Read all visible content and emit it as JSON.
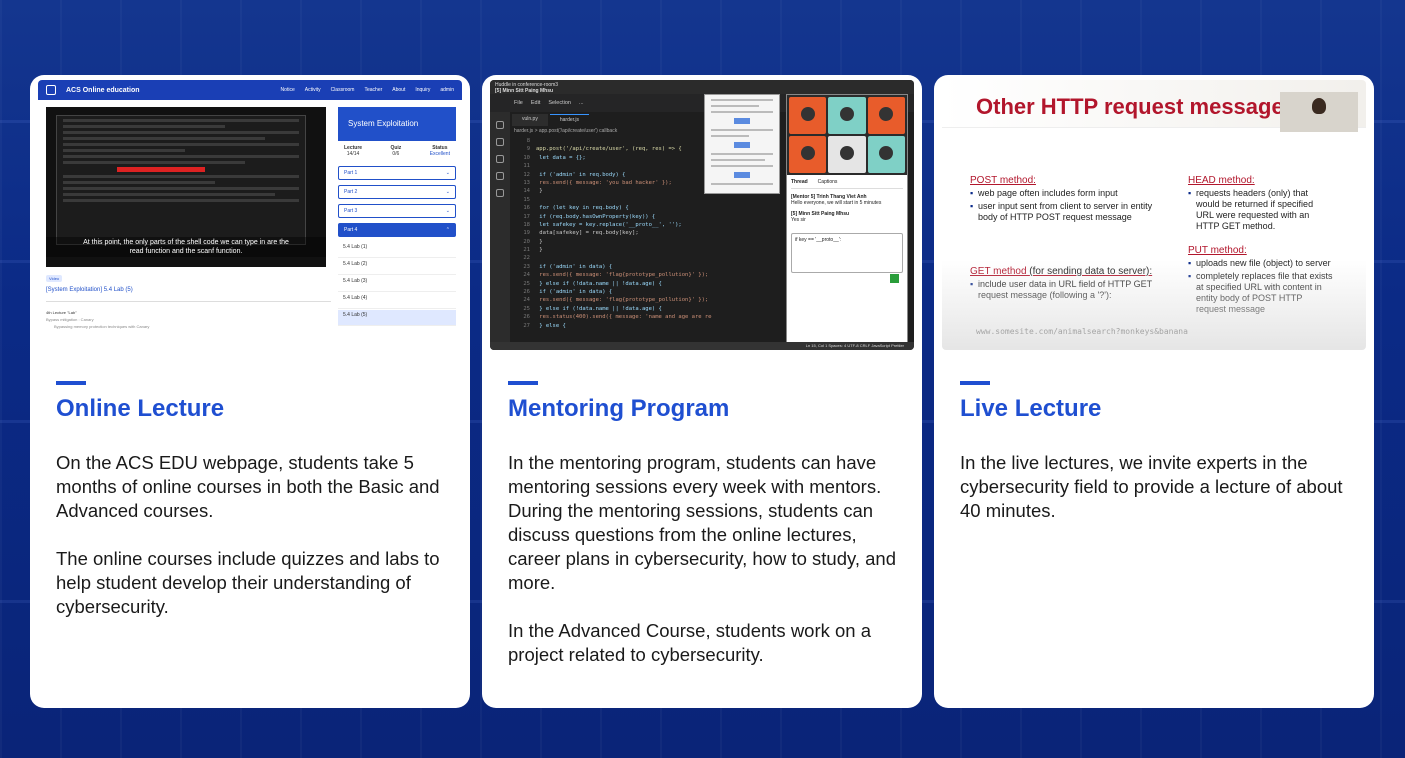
{
  "cards": [
    {
      "title": "Online Lecture",
      "paragraphs": [
        "On the ACS EDU webpage, students take 5 months of online courses in both the Basic and Advanced courses.",
        "The online courses include quizzes and labs to help student develop their understanding of cybersecurity."
      ]
    },
    {
      "title": "Mentoring Program",
      "paragraphs": [
        "In the mentoring program, students can have mentoring sessions every week with mentors. During the mentoring sessions, students can discuss questions from the online lectures, career plans in cybersecurity, how to study, and more.",
        "In the Advanced Course, students work on a project related to cybersecurity."
      ]
    },
    {
      "title": "Live Lecture",
      "paragraphs": [
        "In the live lectures, we invite experts in the cybersecurity field to provide a lecture of about 40 minutes."
      ]
    }
  ],
  "online_site": {
    "brand": "ACS Online education",
    "nav": [
      "Notice",
      "Activity",
      "Classroom",
      "Teacher",
      "About",
      "Inquiry",
      "admin"
    ],
    "caption": "At this point, the only parts of the shell code we can type in are the read function and the scanf function.",
    "side_title": "System Exploitation",
    "stats": [
      {
        "label": "Lecture",
        "value": "14/14"
      },
      {
        "label": "Quiz",
        "value": "0/6"
      },
      {
        "label": "Status",
        "value": "Excellent"
      }
    ],
    "parts": [
      "Part 1",
      "Part 2",
      "Part 3",
      "Part 4"
    ],
    "labs": [
      "5.4 Lab (1)",
      "5.4 Lab (2)",
      "5.4 Lab (3)",
      "5.4 Lab (4)",
      "5.4 Lab (5)"
    ],
    "badge": "Video",
    "lesson_title": "[System Exploitation] 5.4 Lab (5)",
    "lecture_label": "4th Lecture \"Lab\"",
    "topic": "Bypass mitigation : Canary",
    "bullet": "Bypassing memory protection techniques with Canary"
  },
  "mentoring_ide": {
    "window_title": "Huddle in conference-room3",
    "presenter": "[5] Minn Sitt Paing Mhsu",
    "menu": [
      "File",
      "Edit",
      "Selection",
      "..."
    ],
    "tabs": [
      "vuln.py",
      "harder.js"
    ],
    "breadcrumb": "harder.js > app.post('/api/create/user') callback",
    "code_lines": [
      {
        "n": "8",
        "t": ""
      },
      {
        "n": "9",
        "t": "app.post('/api/create/user', (req, res) => {"
      },
      {
        "n": "10",
        "t": "    let data = {};"
      },
      {
        "n": "11",
        "t": ""
      },
      {
        "n": "12",
        "t": "    if ('admin' in req.body) {"
      },
      {
        "n": "13",
        "t": "        res.send({ message: 'you bad hacker' });"
      },
      {
        "n": "14",
        "t": "    }"
      },
      {
        "n": "15",
        "t": ""
      },
      {
        "n": "16",
        "t": "    for (let key in req.body) {"
      },
      {
        "n": "17",
        "t": "        if (req.body.hasOwnProperty(key)) {"
      },
      {
        "n": "18",
        "t": "            let safekey = key.replace('__proto__', '');"
      },
      {
        "n": "19",
        "t": "            data[safekey] = req.body[key];"
      },
      {
        "n": "20",
        "t": "        }"
      },
      {
        "n": "21",
        "t": "    }"
      },
      {
        "n": "22",
        "t": ""
      },
      {
        "n": "23",
        "t": "    if ('admin' in data) {"
      },
      {
        "n": "24",
        "t": "        res.send({ message: 'flag{prototype_pollution}' });"
      },
      {
        "n": "25",
        "t": "    } else if (!data.name || !data.age) {"
      },
      {
        "n": "26",
        "t": "    if ('admin' in data) {"
      },
      {
        "n": "24",
        "t": "        res.send({ message: 'flag{prototype_pollution}' });"
      },
      {
        "n": "25",
        "t": "    } else if (!data.name || !data.age) {"
      },
      {
        "n": "26",
        "t": "        res.status(400).send({ message: 'name and age are required' });"
      },
      {
        "n": "27",
        "t": "    } else {"
      }
    ],
    "thread_tabs": [
      "Thread",
      "Captions"
    ],
    "messages": [
      {
        "who": "[Mentor 5] Trinh Thang Viet Anh",
        "text": "Hello everyone, we will start in 5 minutes"
      },
      {
        "who": "[5] Minn Sitt Paing Mhsu",
        "text": "Yes sir"
      }
    ],
    "draft": "if key == '__proto__':",
    "status_bar": "Ln 15, Col 1   Spaces: 4   UTF-8   CRLF   JavaScript   Prettier"
  },
  "live_slide": {
    "heading": "Other HTTP request messages",
    "post": {
      "title": "POST method:",
      "items": [
        "web page often includes form input",
        "user input sent from client to server in entity body of HTTP POST request message"
      ]
    },
    "get": {
      "title": "GET method",
      "suffix": "(for sending data to server):",
      "items": [
        "include user data in URL field of HTTP GET request message (following a '?'):"
      ]
    },
    "url": "www.somesite.com/animalsearch?monkeys&banana",
    "head": {
      "title": "HEAD method:",
      "items": [
        "requests headers (only) that would be returned if specified URL were requested with an HTTP GET method."
      ]
    },
    "put": {
      "title": "PUT method:",
      "items": [
        "uploads new file (object) to server",
        "completely replaces file that exists at specified URL with content in entity body of POST HTTP request message"
      ]
    }
  },
  "colors": {
    "accent": "#1f4fd1",
    "background": "#0a2a8a",
    "slide_red": "#b2162c"
  }
}
